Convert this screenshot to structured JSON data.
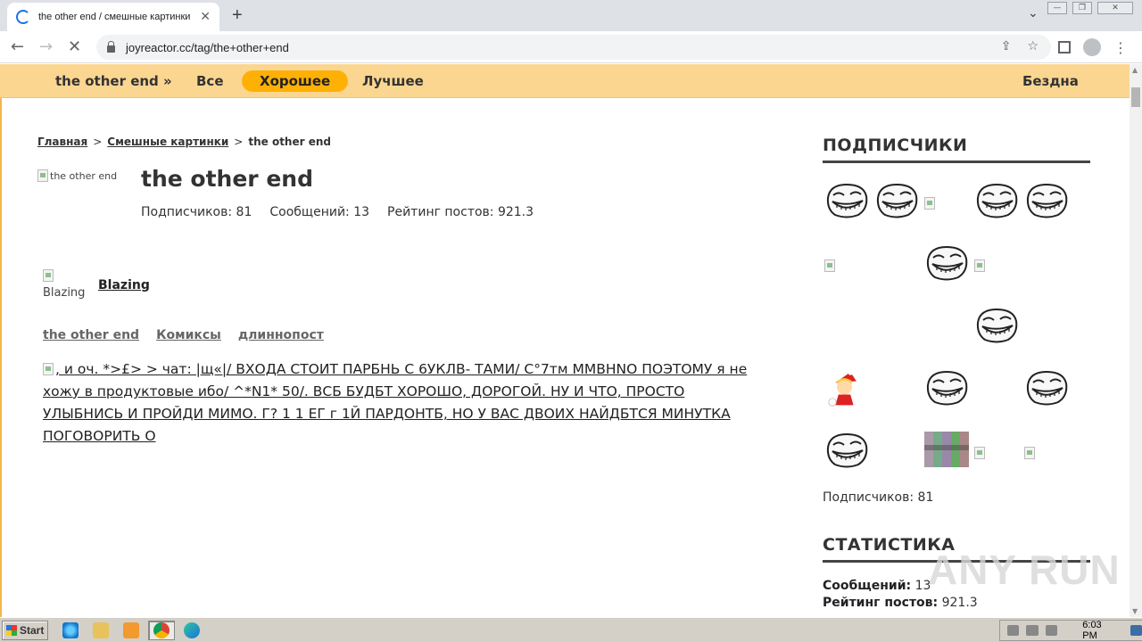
{
  "browser": {
    "tab_title": "the other end / смешные картинки",
    "url": "joyreactor.cc/tag/the+other+end"
  },
  "site_nav": {
    "items": [
      "the other end »",
      "Все",
      "Хорошее",
      "Лучшее"
    ],
    "active": "Хорошее",
    "right_item": "Бездна"
  },
  "breadcrumbs": {
    "home": "Главная",
    "section": "Смешные картинки",
    "current": "the other end",
    "separator": ">"
  },
  "tag": {
    "image_alt": "the other end",
    "title": "the other end",
    "subscribers": "Подписчиков: 81",
    "posts": "Сообщений: 13",
    "rating": "Рейтинг постов: 921.3"
  },
  "post": {
    "author_img_alt": "Blazing",
    "author": "Blazing",
    "tags": [
      "the other end",
      "Комиксы",
      "длиннопост"
    ],
    "text": ", и оч. *>£> > чат: |щ«|/ ВХОДА СТОИТ ПАРБНЬ С 6УКЛВ- ТАМИ/ С°7тм ММВНNО ПОЭТОМУ я не хожу в продуктовые ибо/ ^*N1* 50/. ВСБ БУДБТ ХОРОШО, ДОРОГОЙ. НУ И ЧТО, ПРОСТО УЛЫБНИСЬ И ПРОЙДИ МИМО. Г? 1 1 ЕГ г 1Й ПАРДОНТБ, НО У ВАС ДВОИХ НАЙДБТСЯ МИНУТКА ПОГОВОРИТЬ О"
  },
  "sidebar": {
    "subscribers_heading": "ПОДПИСЧИКИ",
    "subscribers_count": "Подписчиков: 81",
    "stats_heading": "СТАТИСТИКА",
    "stats": [
      {
        "label": "Сообщений:",
        "value": "13"
      },
      {
        "label": "Рейтинг постов:",
        "value": "921.3"
      }
    ]
  },
  "watermark": "ANY RUN",
  "taskbar": {
    "start_label": "Start",
    "clock": "6:03 PM"
  }
}
